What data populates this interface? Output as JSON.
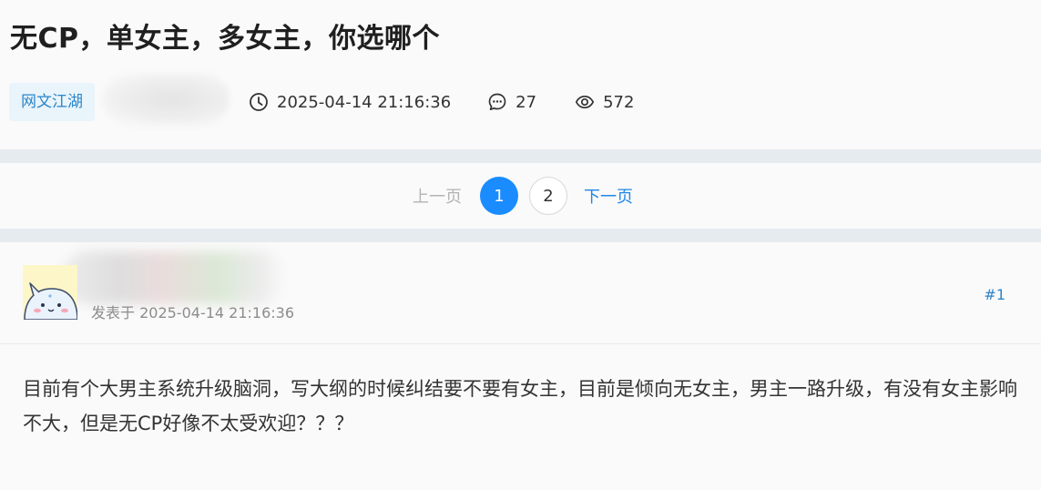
{
  "post": {
    "title": "无CP，单女主，多女主，你选哪个",
    "category_tag": "网文江湖",
    "timestamp": "2025-04-14 21:16:36",
    "reply_count": "27",
    "view_count": "572"
  },
  "icons": {
    "close": "close-icon",
    "time": "clock-icon",
    "replies": "comment-icon",
    "views": "eye-icon"
  },
  "pagination": {
    "prev": "上一页",
    "pages": [
      "1",
      "2"
    ],
    "current": "1",
    "next": "下一页"
  },
  "first_post": {
    "posted_label": "发表于 2025-04-14 21:16:36",
    "floor": "#1",
    "body": "目前有个大男主系统升级脑洞，写大纲的时候纠结要不要有女主，目前是倾向无女主，男主一路升级，有没有女主影响不大，但是无CP好像不太受欢迎？？？"
  },
  "colors": {
    "accent": "#1a8cff",
    "link": "#2a85c8",
    "tag_bg": "#e9f4fb",
    "band": "#e6ebf0"
  }
}
